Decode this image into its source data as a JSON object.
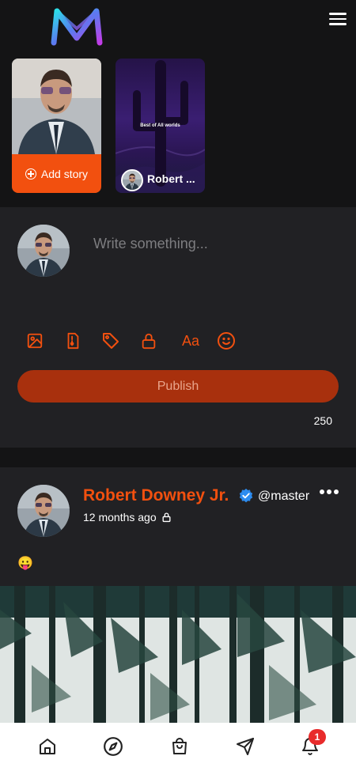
{
  "header": {
    "logo_icon": "logo-m-icon",
    "menu_icon": "hamburger-icon"
  },
  "stories": {
    "add_story_label": "Add story",
    "items": [
      {
        "user_name": "Robert ...",
        "caption": "Best of All worlds"
      }
    ]
  },
  "composer": {
    "placeholder": "Write something...",
    "tools": [
      "image-icon",
      "file-upload-icon",
      "tag-icon",
      "lock-icon",
      "text-format-icon",
      "emoji-icon"
    ],
    "text_format_label": "Aa",
    "publish_label": "Publish",
    "char_count": "250"
  },
  "post": {
    "author": "Robert Downey Jr.",
    "handle": "@master",
    "time": "12 months ago",
    "content": "😛"
  },
  "bottom_nav": {
    "items": [
      "home-icon",
      "explore-icon",
      "shop-icon",
      "messages-icon",
      "notifications-icon"
    ],
    "notification_count": "1"
  },
  "colors": {
    "accent": "#f2500f",
    "publish": "#a8300d",
    "badge": "#e82b2b",
    "panel": "#212124",
    "background": "#141415"
  }
}
